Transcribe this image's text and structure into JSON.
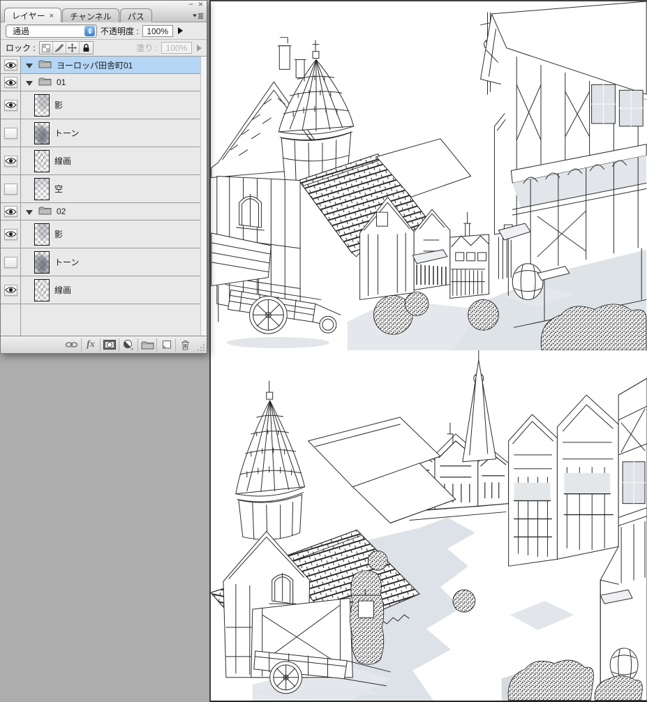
{
  "panel": {
    "window_controls": {
      "minimize": "−",
      "close": "×"
    },
    "tabs": [
      {
        "label": "レイヤー",
        "close": "×"
      },
      {
        "label": "チャンネル"
      },
      {
        "label": "パス"
      }
    ],
    "blend_mode": {
      "value": "通過"
    },
    "opacity": {
      "label": "不透明度 :",
      "value": "100%"
    },
    "lock": {
      "label": "ロック :"
    },
    "fill": {
      "label": "塗り :",
      "value": "100%"
    },
    "layers": [
      {
        "type": "group",
        "name": "ヨーロッパ田舎町01",
        "visible": true,
        "selected": true,
        "depth": 0
      },
      {
        "type": "group",
        "name": "01",
        "visible": true,
        "selected": false,
        "depth": 1
      },
      {
        "type": "layer",
        "name": "影",
        "visible": true,
        "selected": false,
        "depth": 2,
        "thumb": "shadow"
      },
      {
        "type": "layer",
        "name": "トーン",
        "visible": false,
        "selected": false,
        "depth": 2,
        "thumb": "tone"
      },
      {
        "type": "layer",
        "name": "線画",
        "visible": true,
        "selected": false,
        "depth": 2,
        "thumb": "line"
      },
      {
        "type": "layer",
        "name": "空",
        "visible": false,
        "selected": false,
        "depth": 2,
        "thumb": "sky"
      },
      {
        "type": "group",
        "name": "02",
        "visible": true,
        "selected": false,
        "depth": 1
      },
      {
        "type": "layer",
        "name": "影",
        "visible": true,
        "selected": false,
        "depth": 2,
        "thumb": "shadow"
      },
      {
        "type": "layer",
        "name": "トーン",
        "visible": false,
        "selected": false,
        "depth": 2,
        "thumb": "tone"
      },
      {
        "type": "layer",
        "name": "線画",
        "visible": true,
        "selected": false,
        "depth": 2,
        "thumb": "line"
      }
    ],
    "toolbar": {
      "fx_label": "fx"
    }
  },
  "canvas": {
    "images": [
      {
        "name": "european-country-town-street-lineart-top"
      },
      {
        "name": "european-country-town-street-lineart-bottom-shaded"
      }
    ]
  },
  "colors": {
    "selection_blue": "#b5d6f5",
    "panel_bg": "#e9e9e9",
    "desktop_gray": "#adadad",
    "stepper_blue": "#4b8fdd",
    "street_shadow": "#dee3e8"
  }
}
